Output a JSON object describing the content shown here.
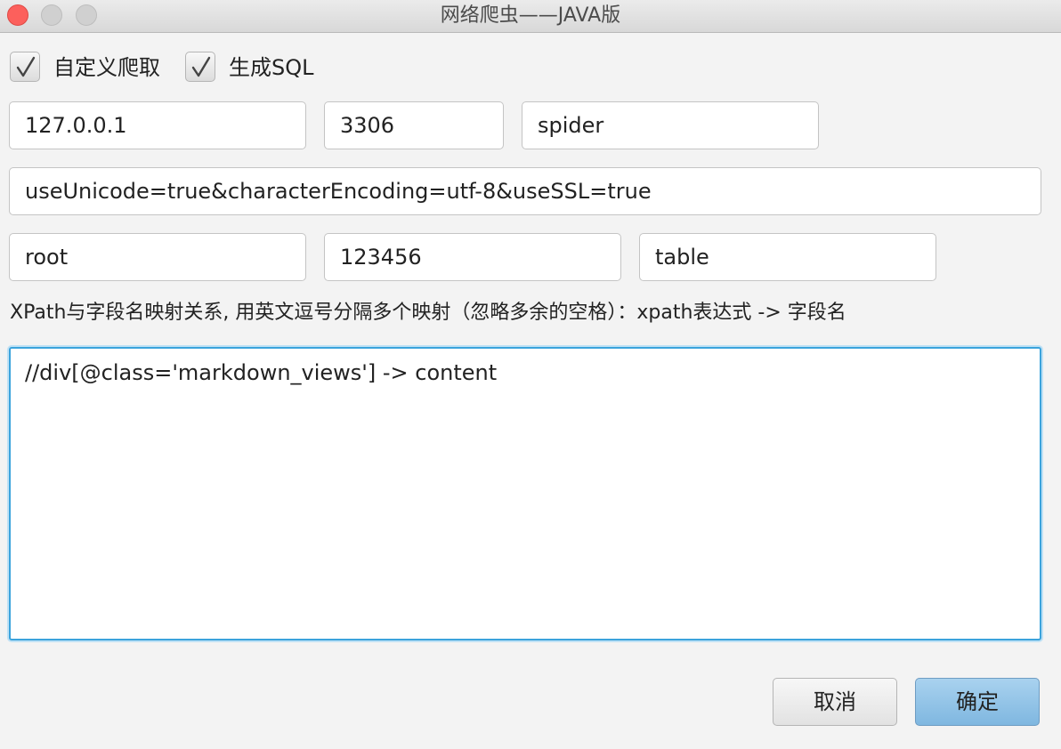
{
  "window": {
    "title": "网络爬虫——JAVA版"
  },
  "options": {
    "custom_crawl": {
      "label": "自定义爬取",
      "checked": true
    },
    "generate_sql": {
      "label": "生成SQL",
      "checked": true
    }
  },
  "db": {
    "host": "127.0.0.1",
    "port": "3306",
    "database": "spider",
    "params": "useUnicode=true&characterEncoding=utf-8&useSSL=true",
    "user": "root",
    "password": "123456",
    "table": "table"
  },
  "mapping": {
    "hint": "XPath与字段名映射关系, 用英文逗号分隔多个映射（忽略多余的空格）：xpath表达式 -> 字段名",
    "value": "//div[@class='markdown_views'] -> content"
  },
  "buttons": {
    "cancel": "取消",
    "ok": "确定"
  },
  "colors": {
    "accent": "#3ba3dc",
    "primary_button": "#8ec3e7",
    "close": "#fc605c"
  }
}
